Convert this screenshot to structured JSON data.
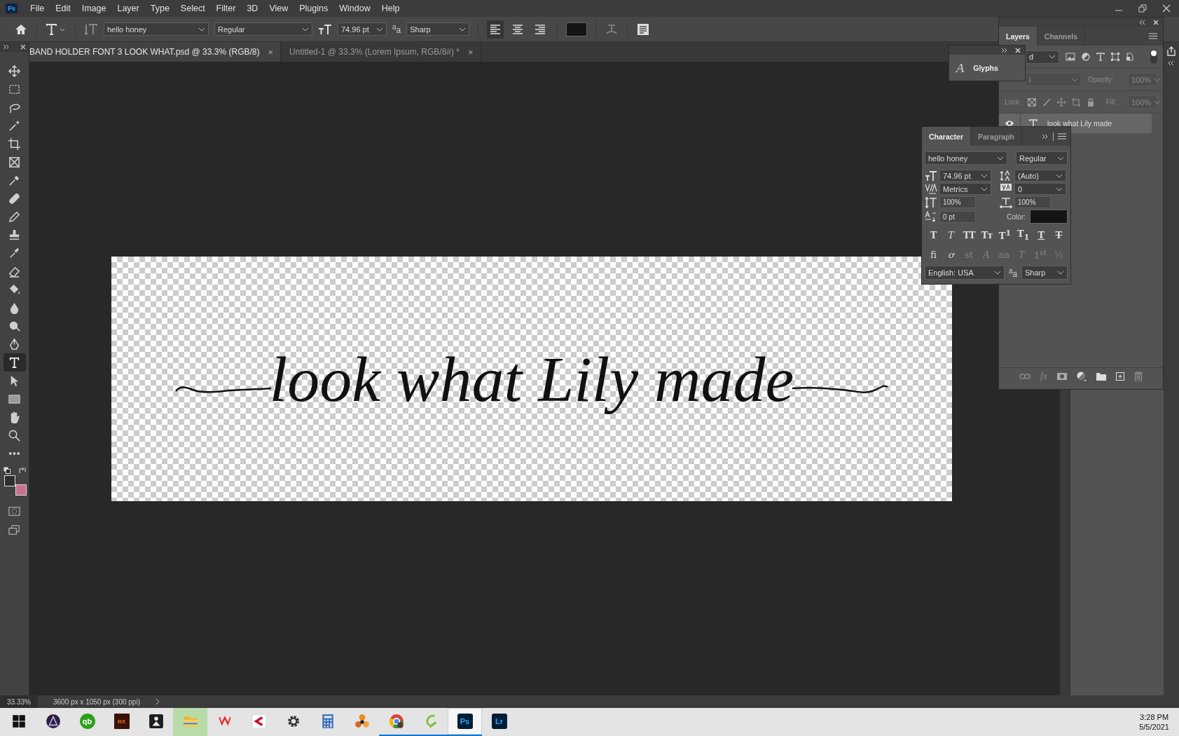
{
  "menu": {
    "logo": "Ps",
    "items": [
      "File",
      "Edit",
      "Image",
      "Layer",
      "Type",
      "Select",
      "Filter",
      "3D",
      "View",
      "Plugins",
      "Window",
      "Help"
    ]
  },
  "options_bar": {
    "font_family": "hello honey",
    "font_style": "Regular",
    "font_size": "74.96 pt",
    "antialias_label": "$^{a}$a",
    "antialias": "Sharp",
    "alignments": [
      {
        "selected": true
      },
      {
        "selected": false
      },
      {
        "selected": false
      }
    ]
  },
  "tabs": [
    {
      "label": "BAND HOLDER FONT 3 LOOK WHAT.psd @ 33.3% (RGB/8)",
      "close": "×",
      "selected": true
    },
    {
      "label": "Untitled-1 @ 33.3% (Lorem Ipsum, RGB/8#) *",
      "close": "×",
      "selected": false
    }
  ],
  "tools": [
    {
      "kind": "move",
      "selected": false
    },
    {
      "kind": "marquee",
      "selected": false
    },
    {
      "kind": "lasso",
      "selected": false
    },
    {
      "kind": "magic-wand",
      "selected": false
    },
    {
      "kind": "crop",
      "selected": false
    },
    {
      "kind": "frame",
      "selected": false
    },
    {
      "kind": "eyedropper",
      "selected": false
    },
    {
      "kind": "bandage",
      "selected": false
    },
    {
      "kind": "pencil",
      "selected": false
    },
    {
      "kind": "stamp",
      "selected": false
    },
    {
      "kind": "brush",
      "selected": false
    },
    {
      "kind": "eraser",
      "selected": false
    },
    {
      "kind": "paint-bucket",
      "selected": false
    },
    {
      "kind": "drop",
      "selected": false
    },
    {
      "kind": "dodge",
      "selected": false
    },
    {
      "kind": "pen",
      "selected": false
    },
    {
      "kind": "type",
      "selected": true
    },
    {
      "kind": "pointer",
      "selected": false
    },
    {
      "kind": "rectangle",
      "selected": false
    },
    {
      "kind": "hand",
      "selected": false
    },
    {
      "kind": "zoom",
      "selected": false
    },
    {
      "kind": "more",
      "selected": false
    }
  ],
  "swatches": [
    {
      "color": "#2e2e2e"
    },
    {
      "color": "#c8718f"
    }
  ],
  "canvas": {
    "text": "look what Lily made"
  },
  "status_bar": {
    "zoom": "33.33%",
    "doc_info": "3600 px x 1050 px (300 ppi)"
  },
  "glyphs_panel": {
    "glyph": "A",
    "title": "Glyphs"
  },
  "layers_panel": {
    "tabs": [
      {
        "label": "Layers",
        "selected": true
      },
      {
        "label": "Channels",
        "selected": false
      }
    ],
    "filter": "d",
    "blend_mode": "l",
    "opacity_label": "Opacity:",
    "opacity": "100%",
    "lock_label": "Lock:",
    "fill_label": "Fill:",
    "fill": "100%",
    "options_disabled": true,
    "fx": "fx",
    "layers": [
      {
        "name": "look what Lily made",
        "visible": true,
        "selected": true
      }
    ]
  },
  "character_panel": {
    "tabs": [
      {
        "label": "Character",
        "selected": true
      },
      {
        "label": "Paragraph",
        "selected": false
      }
    ],
    "font_family": "hello honey",
    "font_style": "Regular",
    "size": "74.96 pt",
    "leading": "(Auto)",
    "kerning": "Metrics",
    "tracking": "0",
    "vertical_scale": "100%",
    "horizontal_scale": "100%",
    "baseline_shift": "0 pt",
    "color_label": "Color:",
    "style_buttons": [
      {
        "kind": "bold",
        "label": "T"
      },
      {
        "kind": "italic",
        "label": "T"
      },
      {
        "kind": "caps",
        "label": "TT"
      },
      {
        "kind": "smallcaps",
        "label": "Tᴛ"
      },
      {
        "kind": "super",
        "label": "T$^{1}$"
      },
      {
        "kind": "sub",
        "label": "T$_{1}$"
      },
      {
        "kind": "underline",
        "label": "T"
      },
      {
        "kind": "strike",
        "label": "T"
      }
    ],
    "opentype_buttons": [
      {
        "kind": "ligature",
        "label": "fi",
        "disabled": false
      },
      {
        "kind": "swash",
        "label": "ơ",
        "disabled": false
      },
      {
        "kind": "plain",
        "label": "st",
        "disabled": true
      },
      {
        "kind": "titling",
        "label": "A",
        "disabled": true
      },
      {
        "kind": "plain",
        "label": "aa",
        "disabled": true
      },
      {
        "kind": "titling",
        "label": "T",
        "disabled": true
      },
      {
        "kind": "plain",
        "label": "1$^{st}$",
        "disabled": true
      },
      {
        "kind": "plain",
        "label": "½",
        "disabled": true
      }
    ],
    "language": "English: USA",
    "antialias_label": "$^{a}$a",
    "antialias": "Sharp"
  },
  "taskbar": {
    "apps": [
      {
        "kind": "start",
        "running": false,
        "selected": false,
        "highlighted": false
      },
      {
        "kind": "triangle",
        "running": false,
        "selected": false,
        "highlighted": false
      },
      {
        "kind": "qb",
        "label": "qb",
        "running": false,
        "selected": false,
        "highlighted": false
      },
      {
        "kind": "rx",
        "label": "RX",
        "running": false,
        "selected": false,
        "highlighted": false
      },
      {
        "kind": "figure",
        "running": false,
        "selected": false,
        "highlighted": false
      },
      {
        "kind": "folder",
        "running": false,
        "selected": false,
        "highlighted": true
      },
      {
        "kind": "wave",
        "running": false,
        "selected": false,
        "highlighted": false
      },
      {
        "kind": "c",
        "running": false,
        "selected": false,
        "highlighted": false
      },
      {
        "kind": "gear",
        "running": false,
        "selected": false,
        "highlighted": false
      },
      {
        "kind": "calculator",
        "running": false,
        "selected": false,
        "highlighted": false
      },
      {
        "kind": "orbs",
        "running": false,
        "selected": false,
        "highlighted": false
      },
      {
        "kind": "browser",
        "running": true,
        "selected": false,
        "highlighted": false
      },
      {
        "kind": "swirl",
        "running": true,
        "selected": false,
        "highlighted": false
      },
      {
        "kind": "ps",
        "label": "Ps",
        "running": true,
        "selected": true,
        "highlighted": false
      },
      {
        "kind": "lr",
        "label": "Lr",
        "running": false,
        "selected": false,
        "highlighted": false
      }
    ],
    "time": "3:28 PM",
    "date": "5/5/2021"
  }
}
